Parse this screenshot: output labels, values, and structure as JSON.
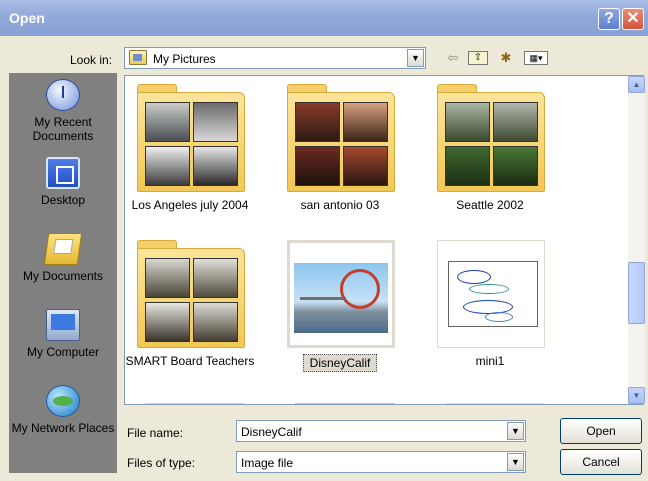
{
  "window": {
    "title": "Open",
    "help_label": "?",
    "close_label": "✕"
  },
  "toolbar": {
    "look_in_label": "Look in:",
    "look_in_value": "My Pictures",
    "dropdown_glyph": "▼",
    "back_glyph": "⇦",
    "up_glyph": "⇧",
    "new_folder_glyph": "✱",
    "view_glyph": "▦▾"
  },
  "places": [
    {
      "label": "My Recent Documents",
      "icon": "recent-documents-icon"
    },
    {
      "label": "Desktop",
      "icon": "desktop-icon"
    },
    {
      "label": "My Documents",
      "icon": "my-documents-icon"
    },
    {
      "label": "My Computer",
      "icon": "my-computer-icon"
    },
    {
      "label": "My Network Places",
      "icon": "network-places-icon"
    }
  ],
  "files": [
    {
      "name": "Los Angeles july 2004",
      "type": "folder"
    },
    {
      "name": "san antonio 03",
      "type": "folder"
    },
    {
      "name": "Seattle 2002",
      "type": "folder"
    },
    {
      "name": "SMART Board Teachers",
      "type": "folder"
    },
    {
      "name": "DisneyCalif",
      "type": "image",
      "selected": true
    },
    {
      "name": "mini1",
      "type": "image"
    }
  ],
  "scrollbar": {
    "up_glyph": "▲",
    "down_glyph": "▼"
  },
  "form": {
    "file_name_label": "File name:",
    "file_name_value": "DisneyCalif",
    "file_type_label": "Files of type:",
    "file_type_value": "Image file"
  },
  "buttons": {
    "open": "Open",
    "cancel": "Cancel"
  }
}
